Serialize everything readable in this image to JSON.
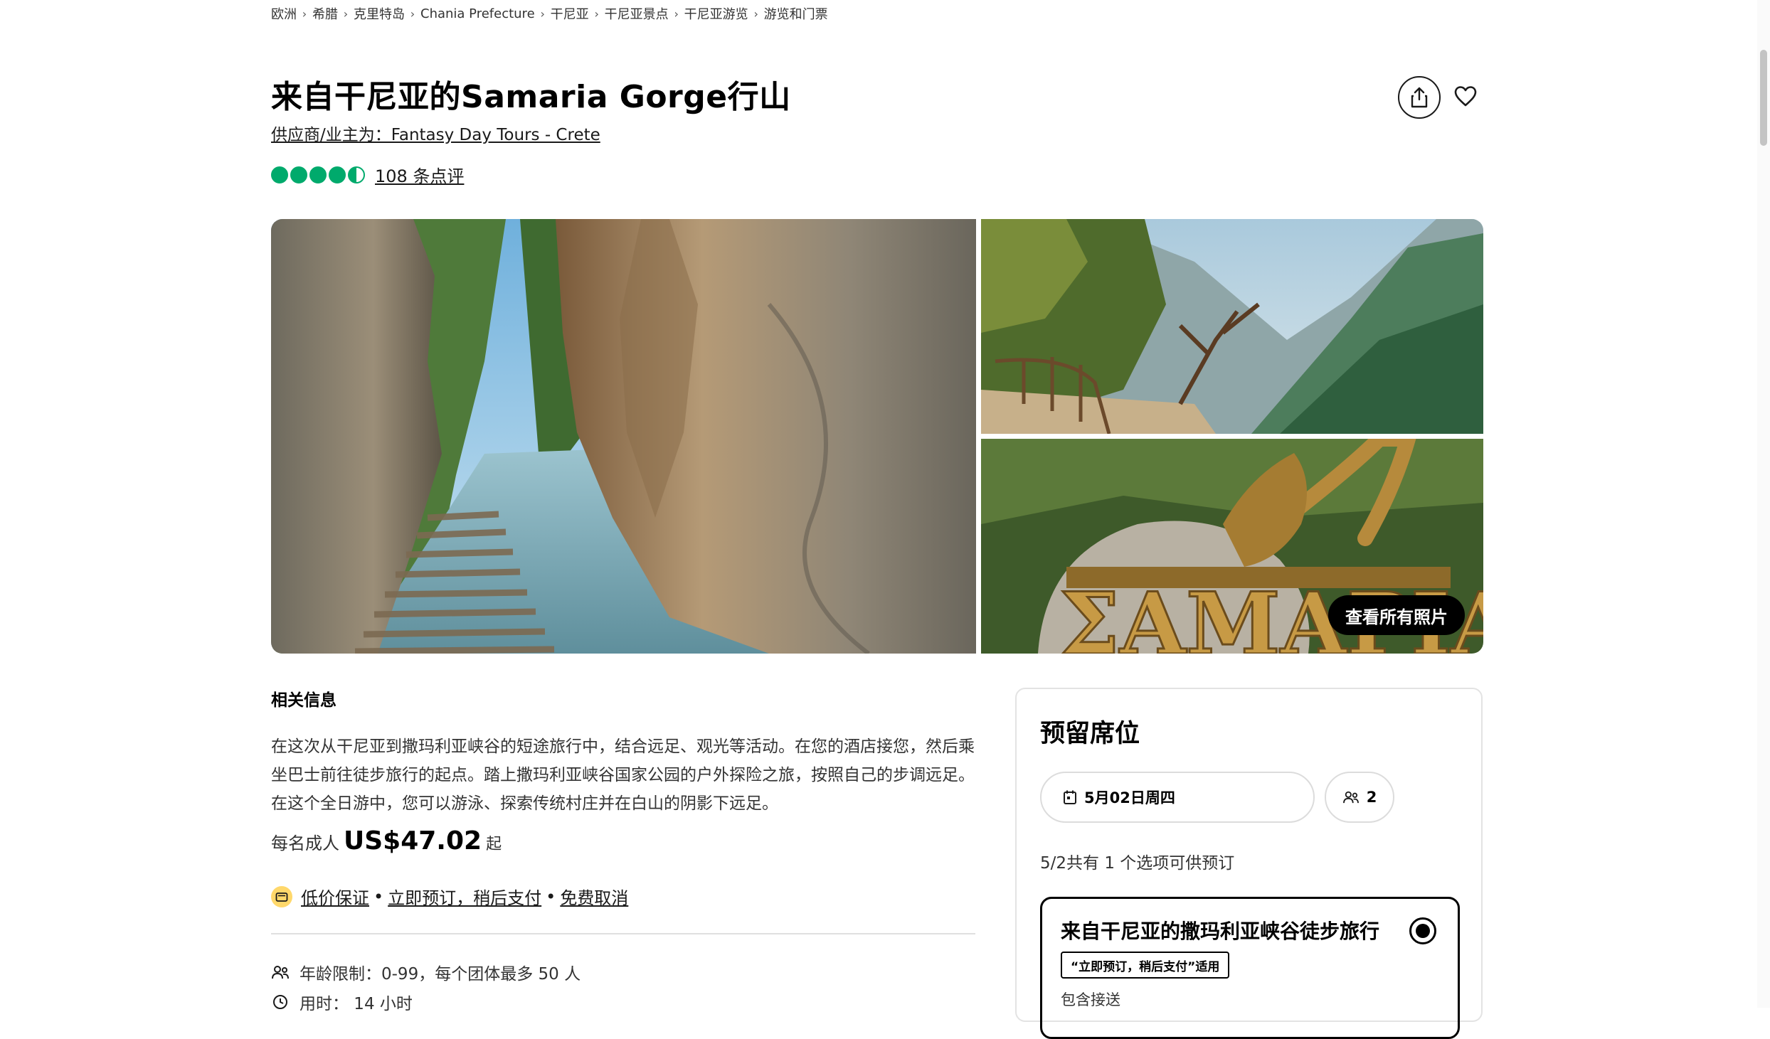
{
  "breadcrumb": [
    "欧洲",
    "希腊",
    "克里特岛",
    "Chania Prefecture",
    "干尼亚",
    "干尼亚景点",
    "干尼亚游览",
    "游览和门票"
  ],
  "title": "来自干尼亚的Samaria Gorge行山",
  "supplier": "供应商/业主为：Fantasy Day Tours - Crete",
  "rating": {
    "value": 4.5,
    "max": 5,
    "reviews_label": "108 条点评"
  },
  "gallery": {
    "view_all_label": "查看所有照片",
    "sign_text": "ΣΑΜΑΡΙΑ"
  },
  "info": {
    "section_title": "相关信息",
    "description": "在这次从干尼亚到撒玛利亚峡谷的短途旅行中，结合远足、观光等活动。在您的酒店接您，然后乘坐巴士前往徒步旅行的起点。踏上撒玛利亚峡谷国家公园的户外探险之旅，按照自己的步调远足。在这个全日游中，您可以游泳、探索传统村庄并在白山的阴影下远足。",
    "price_prefix": "每名成人",
    "price": "US$47.02",
    "price_suffix": "起",
    "perks": [
      "低价保证",
      "立即预订，稍后支付",
      "免费取消"
    ],
    "facts": [
      "年龄限制：0-99，每个团体最多 50 人",
      "用时： 14 小时"
    ]
  },
  "booking": {
    "title": "预留席位",
    "date": "5月02日周四",
    "guests": "2",
    "availability": "5/2共有 1 个选项可供预订",
    "option": {
      "title": "来自干尼亚的撒玛利亚峡谷徒步旅行",
      "badge": "“立即预订，稍后支付”适用",
      "pickup": "包含接送"
    }
  },
  "colors": {
    "rating_green": "#00aa6c",
    "perk_yellow": "#ffd86b",
    "button_black": "#000000"
  }
}
